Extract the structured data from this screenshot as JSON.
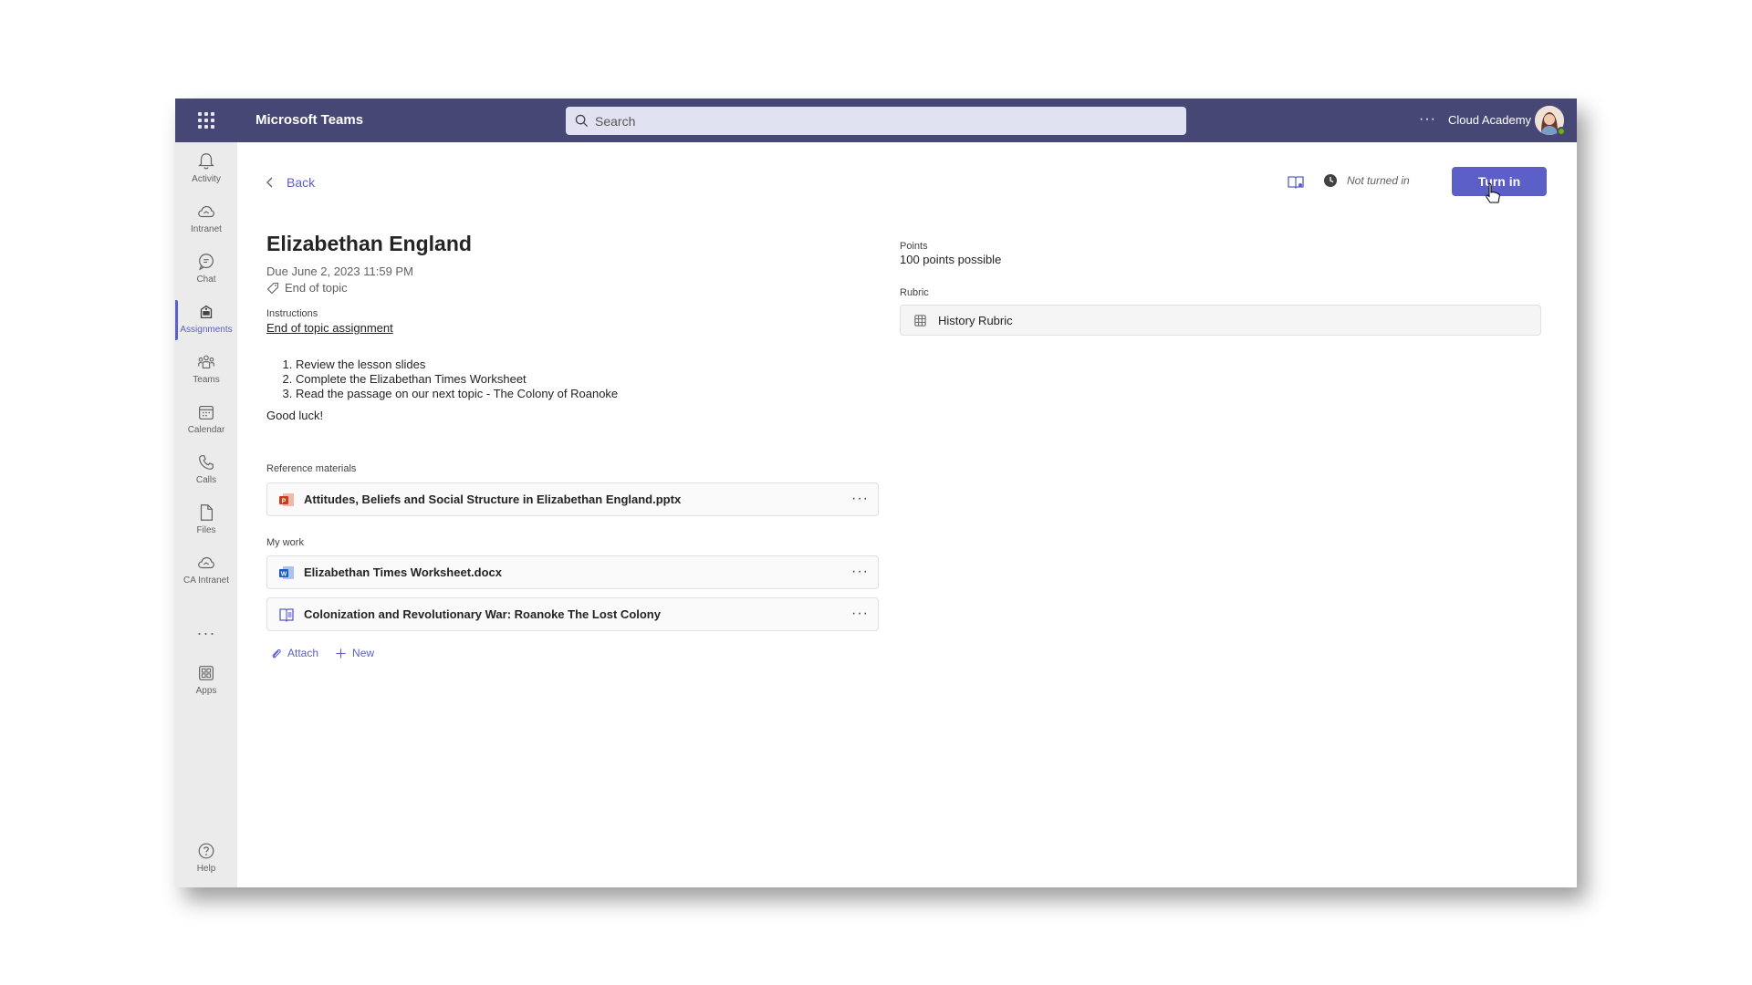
{
  "topbar": {
    "app_title": "Microsoft Teams",
    "search_placeholder": "Search",
    "org_name": "Cloud Academy",
    "more": "···",
    "color": "#464775"
  },
  "rail": {
    "items": [
      {
        "label": "Activity",
        "icon": "bell-icon"
      },
      {
        "label": "Intranet",
        "icon": "cloud-icon"
      },
      {
        "label": "Chat",
        "icon": "chat-icon"
      },
      {
        "label": "Assignments",
        "icon": "assignments-icon",
        "active": true
      },
      {
        "label": "Teams",
        "icon": "teams-icon"
      },
      {
        "label": "Calendar",
        "icon": "calendar-icon"
      },
      {
        "label": "Calls",
        "icon": "phone-icon"
      },
      {
        "label": "Files",
        "icon": "file-icon"
      },
      {
        "label": "CA Intranet",
        "icon": "cloud-icon"
      },
      {
        "label": "Apps",
        "icon": "apps-icon"
      },
      {
        "label": "Help",
        "icon": "help-icon"
      }
    ],
    "more": "···"
  },
  "main": {
    "back_label": "Back",
    "status": "Not turned in",
    "turn_in_label": "Turn in",
    "accent": "#5b5fc7",
    "title": "Elizabethan England",
    "due": "Due June 2, 2023 11:59 PM",
    "tag": "End of topic",
    "instructions_label": "Instructions",
    "instructions_link": "End of topic assignment",
    "steps": [
      "Review the lesson slides",
      "Complete the Elizabethan Times Worksheet",
      "Read the passage on our next topic - The Colony of Roanoke"
    ],
    "closing": "Good luck!",
    "reference_label": "Reference materials",
    "reference_files": [
      {
        "name": "Attitudes, Beliefs and Social Structure in Elizabethan England.pptx",
        "icon": "powerpoint-icon"
      }
    ],
    "mywork_label": "My work",
    "mywork_files": [
      {
        "name": "Elizabethan Times Worksheet.docx",
        "icon": "word-icon"
      },
      {
        "name": "Colonization and Revolutionary War: Roanoke The Lost Colony",
        "icon": "reading-icon"
      }
    ],
    "file_more": "···",
    "attach_label": "Attach",
    "new_label": "New",
    "points_label": "Points",
    "points_value": "100 points possible",
    "rubric_label": "Rubric",
    "rubric_name": "History Rubric"
  }
}
